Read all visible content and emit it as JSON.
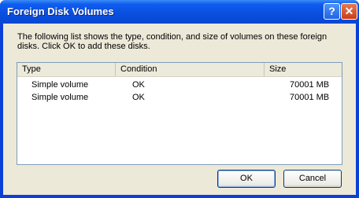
{
  "window": {
    "title": "Foreign Disk Volumes",
    "help_glyph": "?",
    "close_glyph": "✕"
  },
  "description": "The following list shows the type, condition, and size of volumes on these foreign disks. Click OK to add these disks.",
  "table": {
    "columns": [
      "Type",
      "Condition",
      "Size"
    ],
    "rows": [
      {
        "type": "Simple volume",
        "condition": "OK",
        "size": "70001 MB"
      },
      {
        "type": "Simple volume",
        "condition": "OK",
        "size": "70001 MB"
      }
    ]
  },
  "buttons": {
    "ok": "OK",
    "cancel": "Cancel"
  },
  "colors": {
    "titlebar": "#0a4fe0",
    "close_button": "#c83d17",
    "dialog_bg": "#ece9d8"
  }
}
